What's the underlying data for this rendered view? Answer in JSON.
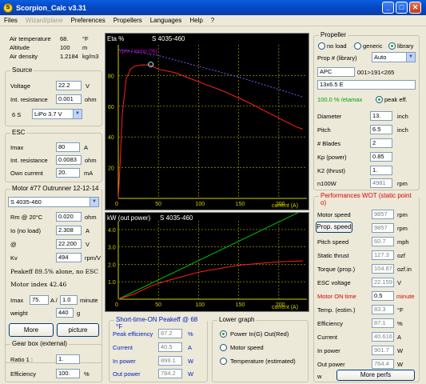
{
  "window": {
    "title": "Scorpion_Calc v3.31"
  },
  "menu": [
    "Files",
    "Wizard/plane",
    "Preferences",
    "Propellers",
    "Languages",
    "Help",
    "?"
  ],
  "air": {
    "temp_label": "Air temperature",
    "temp_value": "68.",
    "temp_unit": "°F",
    "alt_label": "Altitude",
    "alt_value": "100",
    "alt_unit": "m",
    "dens_label": "Air density",
    "dens_value": "1.2184",
    "dens_unit": "kg/m3"
  },
  "source": {
    "title": "Source",
    "voltage_label": "Voltage",
    "voltage_value": "22.2",
    "voltage_unit": "V",
    "ir_label": "Int. resistance",
    "ir_value": "0.001",
    "ir_unit": "ohm",
    "cells": "6 S",
    "battery": "LiPo 3.7 V"
  },
  "esc": {
    "title": "ESC",
    "imax_label": "Imax",
    "imax_value": "80",
    "imax_unit": "A",
    "ir_label": "Int. resistance",
    "ir_value": "0.0083",
    "ir_unit": "ohm",
    "own_label": "Own current",
    "own_value": "20.",
    "own_unit": "mA"
  },
  "motor": {
    "title": "Motor #77   Outrunner 12-12-14",
    "model": "S 4035-460",
    "rm_label": "Rm @ 20°C",
    "rm_value": "0.020",
    "rm_unit": "ohm",
    "io_label": "Io (no load)",
    "io_value": "2.308",
    "io_unit": "A",
    "at_label": "@",
    "at_value": "22.200",
    "at_unit": "V",
    "kv_label": "Kv",
    "kv_value": "494",
    "kv_unit": "rpm/V",
    "peakeff": "Peakeff  89.5% alone, no ESC",
    "index": "Motor index  42.46",
    "imax_label": "Imax",
    "imax_value": "75.",
    "imax_sep": "A /",
    "imax_min": "1.0",
    "imax_min_unit": "minute",
    "weight_label": "weight",
    "weight_value": "440",
    "weight_unit": "g",
    "more_label": "More",
    "picture_label": "picture"
  },
  "gearbox": {
    "title": "Gear box (external)",
    "ratio_label": "Ratio 1 :",
    "ratio_value": "1.",
    "eff_label": "Efficiency",
    "eff_value": "100.",
    "eff_unit": "%"
  },
  "chart_top": {
    "ylabel": "Eta %",
    "series_label": "S 4035-460",
    "legend": "rpm / rpmo (%)",
    "xlabel": "current (A)",
    "yticks": [
      "80",
      "60",
      "40",
      "20"
    ],
    "xticks": [
      "0",
      "50",
      "100",
      "150",
      "200"
    ],
    "colors": {
      "eta": "#ff2020",
      "rpm": "#6060ff",
      "grid": "#d0d000",
      "marker": "#80ffff"
    }
  },
  "chart_top_data": {
    "type": "line",
    "x_range": [
      0,
      235
    ],
    "y_range": [
      0,
      100
    ],
    "series": [
      {
        "name": "Eta %",
        "color": "#ff2020",
        "x": [
          0,
          2,
          5,
          10,
          15,
          20,
          30,
          40,
          50,
          70,
          100,
          130,
          160,
          190,
          220,
          230
        ],
        "y": [
          0,
          20,
          55,
          78,
          84,
          86,
          87,
          86.8,
          84,
          82,
          76,
          70,
          63,
          55,
          47,
          45
        ]
      },
      {
        "name": "rpm / rpmo (%)",
        "color": "#6060ff",
        "x": [
          0,
          50,
          100,
          150,
          200,
          230
        ],
        "y": [
          97,
          93,
          86,
          79,
          71,
          66
        ]
      }
    ]
  },
  "chart_bottom": {
    "ylabel": "kW (out power)",
    "series_label": "S 4035-460",
    "xlabel": "current (A)",
    "yticks": [
      "4.0",
      "3.0",
      "2.0",
      "1.0"
    ],
    "xticks": [
      "0",
      "50",
      "100",
      "150",
      "200"
    ]
  },
  "chart_bottom_data": {
    "type": "line",
    "x_range": [
      0,
      235
    ],
    "y_range": [
      0,
      4.5
    ],
    "series": [
      {
        "name": "In power",
        "color": "#00c000",
        "x": [
          0,
          230
        ],
        "y": [
          0,
          5.1
        ]
      },
      {
        "name": "Out power",
        "color": "#ff2020",
        "x": [
          0,
          20,
          40,
          60,
          100,
          150,
          200,
          230
        ],
        "y": [
          0,
          0.3,
          0.75,
          1.05,
          1.55,
          1.95,
          2.15,
          2.2
        ]
      }
    ]
  },
  "shorttime": {
    "title": "Short-time-ON Peakeff @ 68 °F",
    "peak_label": "Peak efficiency",
    "peak_value": "87.2",
    "peak_unit": "%",
    "cur_label": "Current",
    "cur_value": "40.5",
    "cur_unit": "A",
    "in_label": "In power",
    "in_value": "899.1",
    "in_unit": "W",
    "out_label": "Out power",
    "out_value": "784.2",
    "out_unit": "W"
  },
  "lowergraph": {
    "title": "Lower graph",
    "opt1": "Power In(G)  Out(Red)",
    "opt2": "Motor speed",
    "opt3": "Temperature (estimated)"
  },
  "propeller": {
    "title": "Propeller",
    "noload": "no load",
    "generic": "generic",
    "library": "library",
    "lib_label": "Prop # (library)",
    "lib_value": "Auto",
    "brand": "APC",
    "range": "001>191<265",
    "size": "13x6.5 E",
    "etamax": "100.0 % /etamax",
    "peakeff": "peak eff.",
    "diam_label": "Diameter",
    "diam_value": "13.",
    "diam_unit": "inch",
    "pitch_label": "Pitch",
    "pitch_value": "6.5",
    "pitch_unit": "inch",
    "blades_label": "# Blades",
    "blades_value": "2",
    "kp_label": "Kp (power)",
    "kp_value": "0.85",
    "k2_label": "K2 (thrust)",
    "k2_value": "1.",
    "n100_label": "n100W",
    "n100_value": "4981",
    "n100_unit": "rpm"
  },
  "perf": {
    "title": "Performances WOT (static point o)",
    "speed_label": "Motor speed",
    "speed_value": "9857",
    "speed_unit": "rpm",
    "prop_btn": "Prop. speed",
    "prop_value": "9857",
    "prop_unit": "rpm",
    "pitchsp_label": "Pitch speed",
    "pitchsp_value": "60.7",
    "pitchsp_unit": "mph",
    "thrust_label": "Static thrust",
    "thrust_value": "127.3",
    "thrust_unit": "ozf",
    "torque_label": "Torque (prop.)",
    "torque_value": "104.87",
    "torque_unit": "ozf.in",
    "escv_label": "ESC voltage",
    "escv_value": "22.159",
    "escv_unit": "V",
    "on_label": "Motor ON time",
    "on_value": "0.5",
    "on_unit": "minute",
    "temp_label": "Temp. (estim.)",
    "temp_value": "83.3",
    "temp_unit": "°F",
    "eff_label": "Efficiency",
    "eff_value": "87.1",
    "eff_unit": "%",
    "cur_label": "Current",
    "cur_value": "40.616",
    "cur_unit": "A",
    "inp_label": "In power",
    "inp_value": "901.7",
    "inp_unit": "W",
    "outp_label": "Out power",
    "outp_value": "764.4",
    "outp_unit": "W",
    "w_label": "w",
    "more_btn": "More perfs"
  }
}
